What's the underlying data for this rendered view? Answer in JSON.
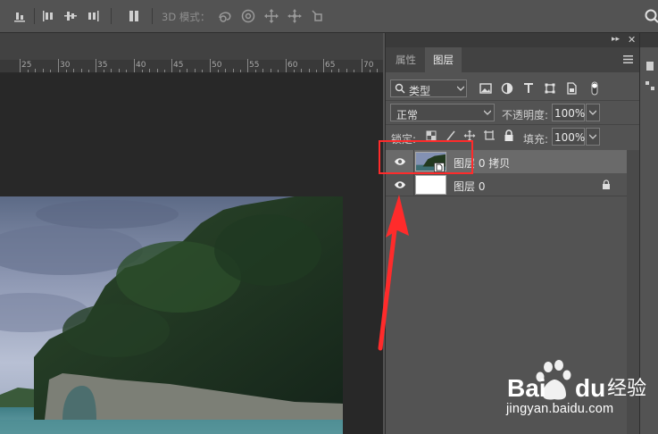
{
  "options_bar": {
    "mode_3d_label": "3D 模式：",
    "icons": [
      "align-bottom-icon",
      "distribute-top-icon",
      "distribute-vcenter-icon",
      "distribute-bottom-icon",
      "distribute-left-icon",
      "auto-align-icon",
      "orbit-3d-icon",
      "roll-3d-icon",
      "drag-3d-icon",
      "slide-3d-icon",
      "scale-3d-icon",
      "search-icon"
    ]
  },
  "ruler": {
    "ticks": [
      "25",
      "30",
      "35",
      "40",
      "45",
      "50",
      "55",
      "60",
      "65",
      "70"
    ]
  },
  "layers_panel": {
    "tabs": [
      {
        "label": "属性",
        "active": false
      },
      {
        "label": "图层",
        "active": true
      }
    ],
    "filter": {
      "label": "类型"
    },
    "blend_mode": "正常",
    "opacity_label": "不透明度:",
    "opacity_value": "100%",
    "lock_label": "锁定:",
    "fill_label": "填充:",
    "fill_value": "100%",
    "layers": [
      {
        "name": "图层 0 拷贝",
        "visible": true,
        "selected": true,
        "thumbnail": "photo",
        "locked": false
      },
      {
        "name": "图层 0",
        "visible": true,
        "selected": false,
        "thumbnail": "white",
        "locked": true
      }
    ]
  },
  "colors": {
    "ui_background": "#535353",
    "canvas_background": "#282828",
    "selected_row": "#6a6a6a",
    "annotation_red": "#ff2b2b"
  },
  "watermark": {
    "logo_text": "Baidu经验",
    "url": "jingyan.baidu.com"
  }
}
